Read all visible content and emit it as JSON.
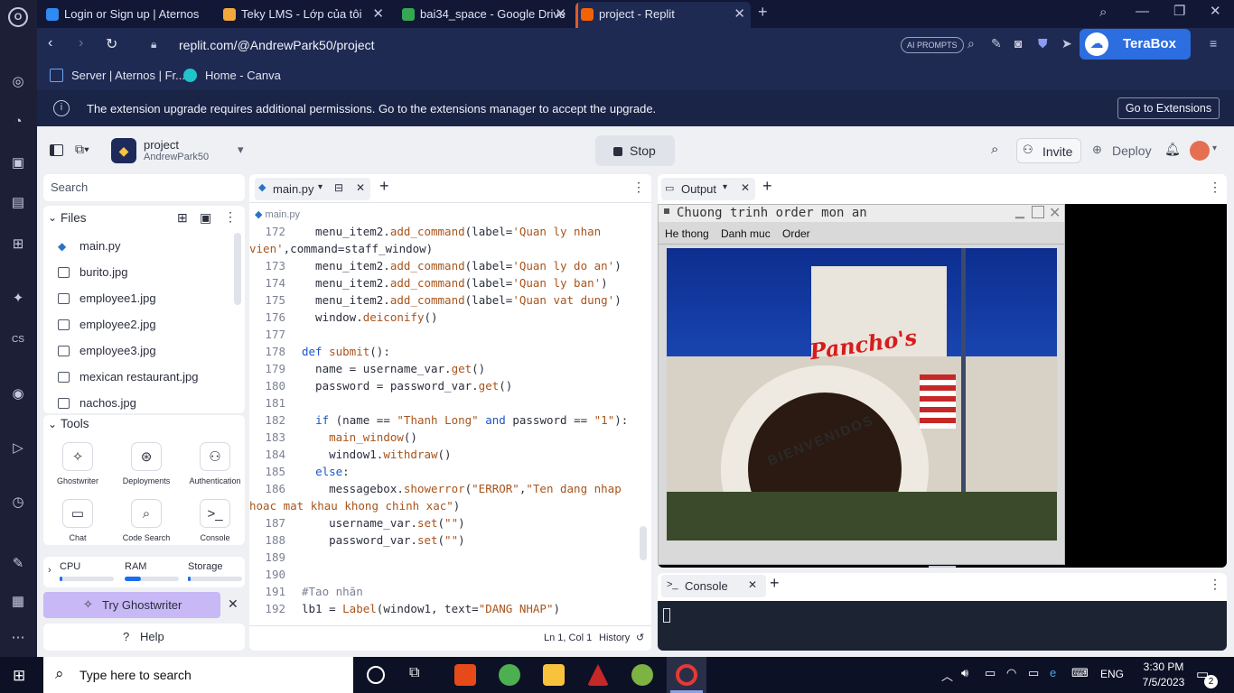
{
  "browser": {
    "tabs": [
      {
        "title": "Login or Sign up | Aternos",
        "fav_color": "#2f8af2"
      },
      {
        "title": "Teky LMS - Lớp của tôi",
        "fav_color": "#f2a93b"
      },
      {
        "title": "bai34_space - Google Drive",
        "fav_color": "#34a853"
      },
      {
        "title": "project - Replit",
        "fav_color": "#f26207"
      }
    ],
    "url": "replit.com/@AndrewPark50/project",
    "ai_prompts": "AI PROMPTS",
    "terabox": "TeraBox",
    "bookmarks": [
      "Server | Aternos | Fr...",
      "Home - Canva"
    ],
    "notice_text": "The extension upgrade requires additional permissions. Go to the extensions manager to accept the upgrade.",
    "notice_button": "Go to Extensions"
  },
  "replit": {
    "project_name": "project",
    "owner": "AndrewPark50",
    "stop_label": "Stop",
    "invite_label": "Invite",
    "deploy_label": "Deploy",
    "search_placeholder": "Search",
    "files_title": "Files",
    "files": [
      {
        "name": "main.py",
        "type": "python"
      },
      {
        "name": "burito.jpg",
        "type": "image"
      },
      {
        "name": "employee1.jpg",
        "type": "image"
      },
      {
        "name": "employee2.jpg",
        "type": "image"
      },
      {
        "name": "employee3.jpg",
        "type": "image"
      },
      {
        "name": "mexican restaurant.jpg",
        "type": "image"
      },
      {
        "name": "nachos.jpg",
        "type": "image"
      }
    ],
    "tools_title": "Tools",
    "tools": [
      {
        "label": "Ghostwriter",
        "icon": "ghostwriter-icon"
      },
      {
        "label": "Deployments",
        "icon": "deployments-icon"
      },
      {
        "label": "Authentication",
        "icon": "user-icon"
      },
      {
        "label": "Chat",
        "icon": "chat-icon"
      },
      {
        "label": "Code Search",
        "icon": "search-icon"
      },
      {
        "label": "Console",
        "icon": "terminal-icon"
      }
    ],
    "resources": {
      "cpu_label": "CPU",
      "ram_label": "RAM",
      "storage_label": "Storage",
      "cpu": 0.05,
      "ram": 0.3,
      "storage": 0.05
    },
    "try_ghostwriter": "Try Ghostwriter",
    "help": "Help",
    "editor": {
      "tab_label": "main.py",
      "breadcrumb": "main.py",
      "status_position": "Ln 1, Col 1",
      "history_label": "History",
      "lines": [
        {
          "n": "172",
          "html": "  menu_item2.<span class=\"fn\">add_command</span>(label=<span class=\"st\">'Quan ly nhan</span>"
        },
        {
          "n": "",
          "html": "<span class=\"st\">vien'</span>,command=staff_window)"
        },
        {
          "n": "173",
          "html": "  menu_item2.<span class=\"fn\">add_command</span>(label=<span class=\"st\">'Quan ly do an'</span>)"
        },
        {
          "n": "174",
          "html": "  menu_item2.<span class=\"fn\">add_command</span>(label=<span class=\"st\">'Quan ly ban'</span>)"
        },
        {
          "n": "175",
          "html": "  menu_item2.<span class=\"fn\">add_command</span>(label=<span class=\"st\">'Quan vat dung'</span>)"
        },
        {
          "n": "176",
          "html": "  window.<span class=\"fn\">deiconify</span>()"
        },
        {
          "n": "177",
          "html": ""
        },
        {
          "n": "178",
          "html": "<span class=\"kw\">def</span> <span class=\"fn\">submit</span>():"
        },
        {
          "n": "179",
          "html": "  name = username_var.<span class=\"fn\">get</span>()"
        },
        {
          "n": "180",
          "html": "  password = password_var.<span class=\"fn\">get</span>()"
        },
        {
          "n": "181",
          "html": ""
        },
        {
          "n": "182",
          "html": "  <span class=\"kw\">if</span> (name == <span class=\"st\">\"Thanh Long\"</span> <span class=\"kw\">and</span> password == <span class=\"st\">\"1\"</span>):"
        },
        {
          "n": "183",
          "html": "    <span class=\"fn\">main_window</span>()"
        },
        {
          "n": "184",
          "html": "    window1.<span class=\"fn\">withdraw</span>()"
        },
        {
          "n": "185",
          "html": "  <span class=\"kw\">else</span>:"
        },
        {
          "n": "186",
          "html": "    messagebox.<span class=\"fn\">showerror</span>(<span class=\"st\">\"ERROR\"</span>,<span class=\"st\">\"Ten dang nhap</span>"
        },
        {
          "n": "",
          "html": "<span class=\"st\">hoac mat khau khong chinh xac\"</span>)"
        },
        {
          "n": "187",
          "html": "    username_var.<span class=\"fn\">set</span>(<span class=\"st\">\"\"</span>)"
        },
        {
          "n": "188",
          "html": "    password_var.<span class=\"fn\">set</span>(<span class=\"st\">\"\"</span>)"
        },
        {
          "n": "189",
          "html": ""
        },
        {
          "n": "190",
          "html": ""
        },
        {
          "n": "191",
          "html": "<span class=\"cm\">#Tao nhãn</span>"
        },
        {
          "n": "192",
          "html": "lb1 = <span class=\"fn\">Label</span>(window1, text=<span class=\"st\">\"DANG NHAP\"</span>)"
        }
      ]
    },
    "output": {
      "tab_label": "Output",
      "window_title": "Chuong trinh order mon an",
      "menu": [
        "He thong",
        "Danh muc",
        "Order"
      ],
      "sign_text": "Pancho's",
      "arch_text": "BIENVENIDOS"
    },
    "console": {
      "tab_label": "Console"
    }
  },
  "taskbar": {
    "search_placeholder": "Type here to search",
    "language": "ENG",
    "time": "3:30 PM",
    "date": "7/5/2023",
    "notification_count": "2"
  }
}
